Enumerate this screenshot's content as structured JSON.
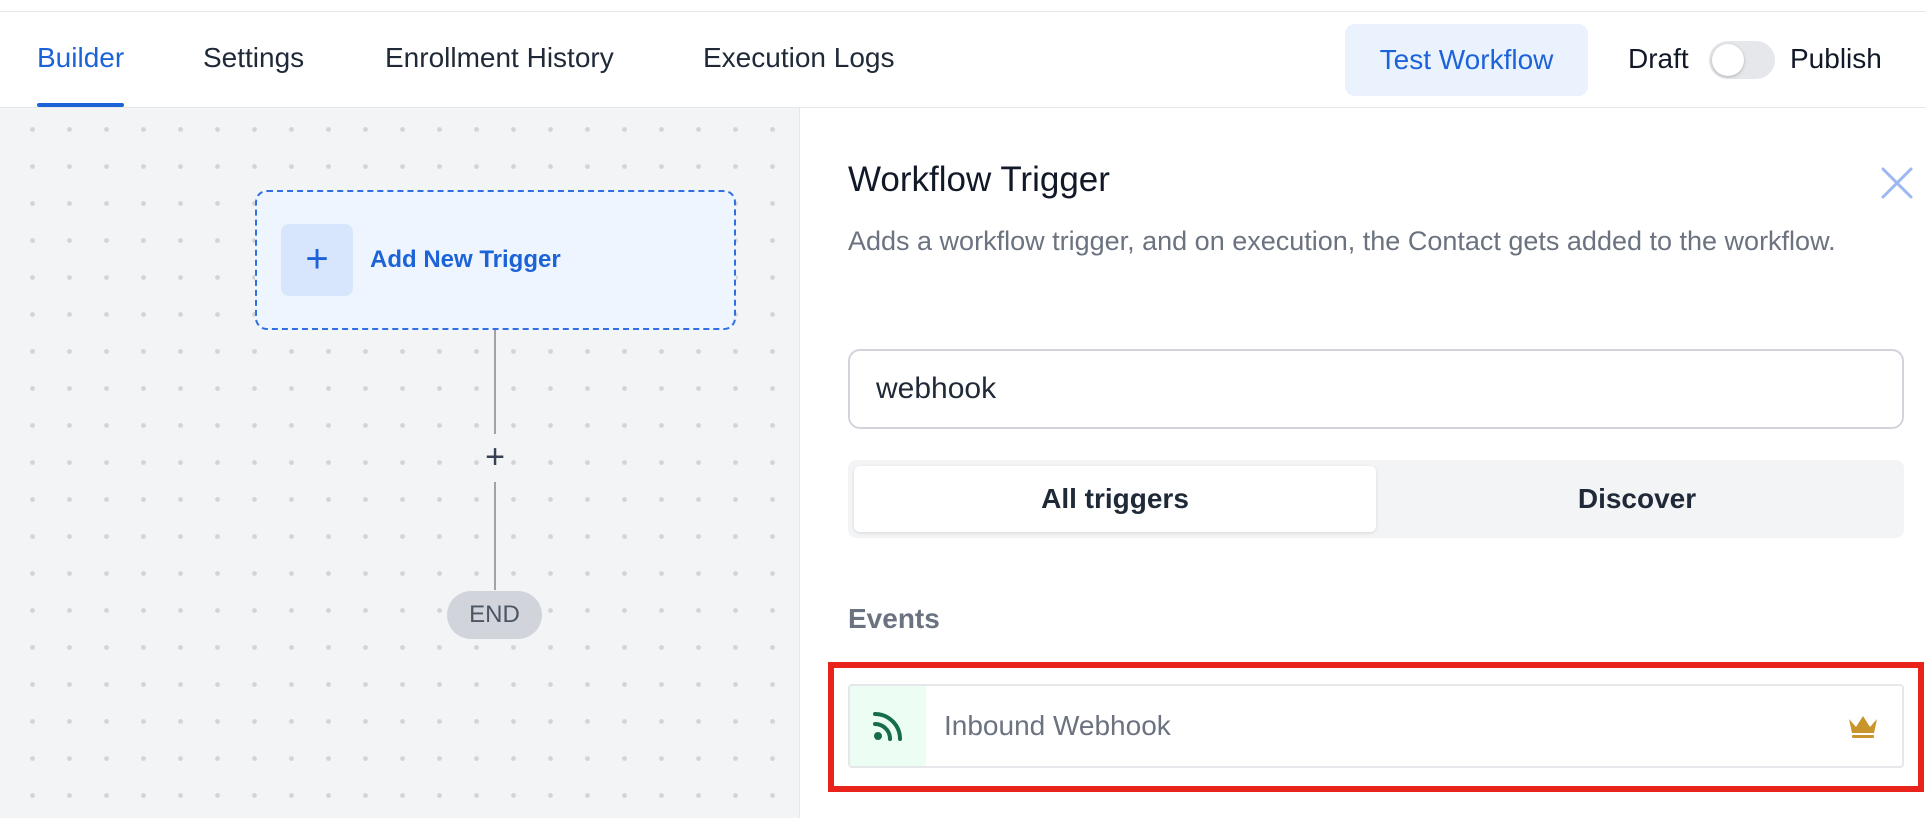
{
  "nav": {
    "tabs": [
      {
        "label": "Builder",
        "active": true
      },
      {
        "label": "Settings",
        "active": false
      },
      {
        "label": "Enrollment History",
        "active": false
      },
      {
        "label": "Execution Logs",
        "active": false
      }
    ],
    "test_button": "Test Workflow",
    "draft_label": "Draft",
    "publish_label": "Publish",
    "publish_toggle_on": false
  },
  "canvas": {
    "trigger_card": {
      "plus_symbol": "+",
      "label": "Add New Trigger"
    },
    "add_step_symbol": "+",
    "end_label": "END"
  },
  "panel": {
    "title": "Workflow Trigger",
    "description": "Adds a workflow trigger, and on execution, the Contact gets added to the workflow.",
    "search": {
      "value": "webhook",
      "placeholder": ""
    },
    "segments": [
      {
        "label": "All triggers",
        "selected": true
      },
      {
        "label": "Discover",
        "selected": false
      }
    ],
    "events_heading": "Events",
    "events": [
      {
        "label": "Inbound Webhook",
        "icon": "rss-webhook-icon",
        "premium_icon": "crown-icon",
        "highlighted": true
      }
    ]
  },
  "colors": {
    "accent": "#1d63d8",
    "highlight_border": "#e8231b",
    "webhook_icon": "#166c4b",
    "crown": "#c8942b"
  }
}
